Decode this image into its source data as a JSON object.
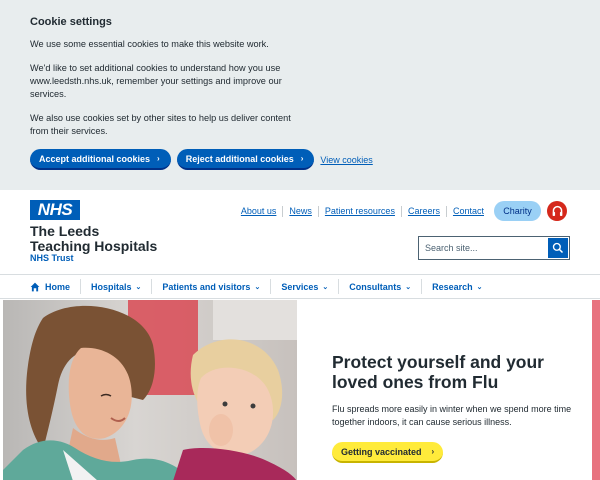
{
  "cookie": {
    "title": "Cookie settings",
    "para1": "We use some essential cookies to make this website work.",
    "para2": "We'd like to set additional cookies to understand how you use www.leedsth.nhs.uk, remember your settings and improve our services.",
    "para3": "We also use cookies set by other sites to help us deliver content from their services.",
    "accept_label": "Accept additional cookies",
    "reject_label": "Reject additional cookies",
    "view_label": "View cookies"
  },
  "header": {
    "logo_text": "NHS",
    "org_line1": "The Leeds",
    "org_line2": "Teaching Hospitals",
    "org_line3": "NHS Trust",
    "top_links": [
      "About us",
      "News",
      "Patient resources",
      "Careers",
      "Contact"
    ],
    "charity_label": "Charity",
    "search_placeholder": "Search site..."
  },
  "nav": {
    "items": [
      "Home",
      "Hospitals",
      "Patients and visitors",
      "Services",
      "Consultants",
      "Research"
    ]
  },
  "hero": {
    "heading": "Protect yourself and your loved ones from Flu",
    "body": "Flu spreads more easily in winter when we spend more time together indoors, it can cause serious illness.",
    "cta_label": "Getting vaccinated"
  },
  "colors": {
    "nhs_blue": "#005eb8",
    "cookie_bg": "#e8edee",
    "cta_yellow": "#ffeb3b",
    "strip_pink": "#e8737f",
    "headset_red": "#d5281b"
  }
}
